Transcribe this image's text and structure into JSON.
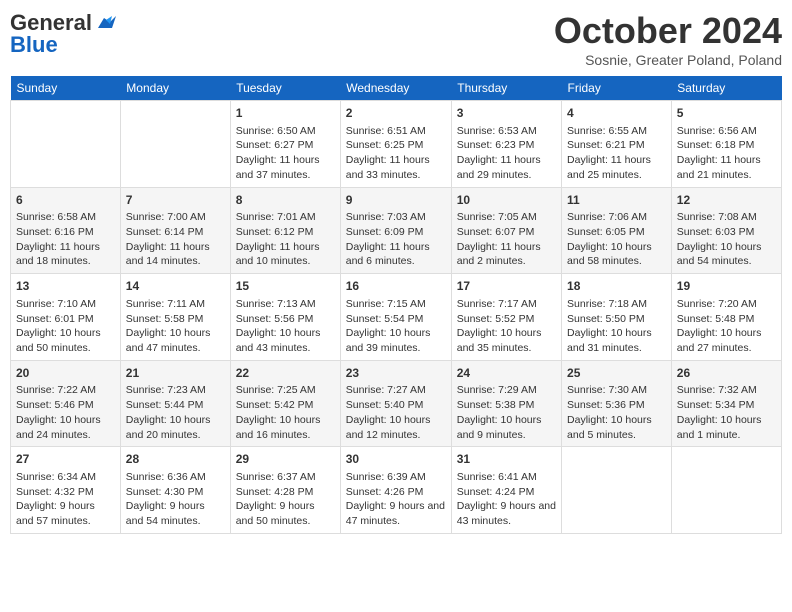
{
  "header": {
    "logo_general": "General",
    "logo_blue": "Blue",
    "month": "October 2024",
    "location": "Sosnie, Greater Poland, Poland"
  },
  "days_of_week": [
    "Sunday",
    "Monday",
    "Tuesday",
    "Wednesday",
    "Thursday",
    "Friday",
    "Saturday"
  ],
  "weeks": [
    [
      {
        "day": "",
        "info": ""
      },
      {
        "day": "",
        "info": ""
      },
      {
        "day": "1",
        "info": "Sunrise: 6:50 AM\nSunset: 6:27 PM\nDaylight: 11 hours and 37 minutes."
      },
      {
        "day": "2",
        "info": "Sunrise: 6:51 AM\nSunset: 6:25 PM\nDaylight: 11 hours and 33 minutes."
      },
      {
        "day": "3",
        "info": "Sunrise: 6:53 AM\nSunset: 6:23 PM\nDaylight: 11 hours and 29 minutes."
      },
      {
        "day": "4",
        "info": "Sunrise: 6:55 AM\nSunset: 6:21 PM\nDaylight: 11 hours and 25 minutes."
      },
      {
        "day": "5",
        "info": "Sunrise: 6:56 AM\nSunset: 6:18 PM\nDaylight: 11 hours and 21 minutes."
      }
    ],
    [
      {
        "day": "6",
        "info": "Sunrise: 6:58 AM\nSunset: 6:16 PM\nDaylight: 11 hours and 18 minutes."
      },
      {
        "day": "7",
        "info": "Sunrise: 7:00 AM\nSunset: 6:14 PM\nDaylight: 11 hours and 14 minutes."
      },
      {
        "day": "8",
        "info": "Sunrise: 7:01 AM\nSunset: 6:12 PM\nDaylight: 11 hours and 10 minutes."
      },
      {
        "day": "9",
        "info": "Sunrise: 7:03 AM\nSunset: 6:09 PM\nDaylight: 11 hours and 6 minutes."
      },
      {
        "day": "10",
        "info": "Sunrise: 7:05 AM\nSunset: 6:07 PM\nDaylight: 11 hours and 2 minutes."
      },
      {
        "day": "11",
        "info": "Sunrise: 7:06 AM\nSunset: 6:05 PM\nDaylight: 10 hours and 58 minutes."
      },
      {
        "day": "12",
        "info": "Sunrise: 7:08 AM\nSunset: 6:03 PM\nDaylight: 10 hours and 54 minutes."
      }
    ],
    [
      {
        "day": "13",
        "info": "Sunrise: 7:10 AM\nSunset: 6:01 PM\nDaylight: 10 hours and 50 minutes."
      },
      {
        "day": "14",
        "info": "Sunrise: 7:11 AM\nSunset: 5:58 PM\nDaylight: 10 hours and 47 minutes."
      },
      {
        "day": "15",
        "info": "Sunrise: 7:13 AM\nSunset: 5:56 PM\nDaylight: 10 hours and 43 minutes."
      },
      {
        "day": "16",
        "info": "Sunrise: 7:15 AM\nSunset: 5:54 PM\nDaylight: 10 hours and 39 minutes."
      },
      {
        "day": "17",
        "info": "Sunrise: 7:17 AM\nSunset: 5:52 PM\nDaylight: 10 hours and 35 minutes."
      },
      {
        "day": "18",
        "info": "Sunrise: 7:18 AM\nSunset: 5:50 PM\nDaylight: 10 hours and 31 minutes."
      },
      {
        "day": "19",
        "info": "Sunrise: 7:20 AM\nSunset: 5:48 PM\nDaylight: 10 hours and 27 minutes."
      }
    ],
    [
      {
        "day": "20",
        "info": "Sunrise: 7:22 AM\nSunset: 5:46 PM\nDaylight: 10 hours and 24 minutes."
      },
      {
        "day": "21",
        "info": "Sunrise: 7:23 AM\nSunset: 5:44 PM\nDaylight: 10 hours and 20 minutes."
      },
      {
        "day": "22",
        "info": "Sunrise: 7:25 AM\nSunset: 5:42 PM\nDaylight: 10 hours and 16 minutes."
      },
      {
        "day": "23",
        "info": "Sunrise: 7:27 AM\nSunset: 5:40 PM\nDaylight: 10 hours and 12 minutes."
      },
      {
        "day": "24",
        "info": "Sunrise: 7:29 AM\nSunset: 5:38 PM\nDaylight: 10 hours and 9 minutes."
      },
      {
        "day": "25",
        "info": "Sunrise: 7:30 AM\nSunset: 5:36 PM\nDaylight: 10 hours and 5 minutes."
      },
      {
        "day": "26",
        "info": "Sunrise: 7:32 AM\nSunset: 5:34 PM\nDaylight: 10 hours and 1 minute."
      }
    ],
    [
      {
        "day": "27",
        "info": "Sunrise: 6:34 AM\nSunset: 4:32 PM\nDaylight: 9 hours and 57 minutes."
      },
      {
        "day": "28",
        "info": "Sunrise: 6:36 AM\nSunset: 4:30 PM\nDaylight: 9 hours and 54 minutes."
      },
      {
        "day": "29",
        "info": "Sunrise: 6:37 AM\nSunset: 4:28 PM\nDaylight: 9 hours and 50 minutes."
      },
      {
        "day": "30",
        "info": "Sunrise: 6:39 AM\nSunset: 4:26 PM\nDaylight: 9 hours and 47 minutes."
      },
      {
        "day": "31",
        "info": "Sunrise: 6:41 AM\nSunset: 4:24 PM\nDaylight: 9 hours and 43 minutes."
      },
      {
        "day": "",
        "info": ""
      },
      {
        "day": "",
        "info": ""
      }
    ]
  ]
}
